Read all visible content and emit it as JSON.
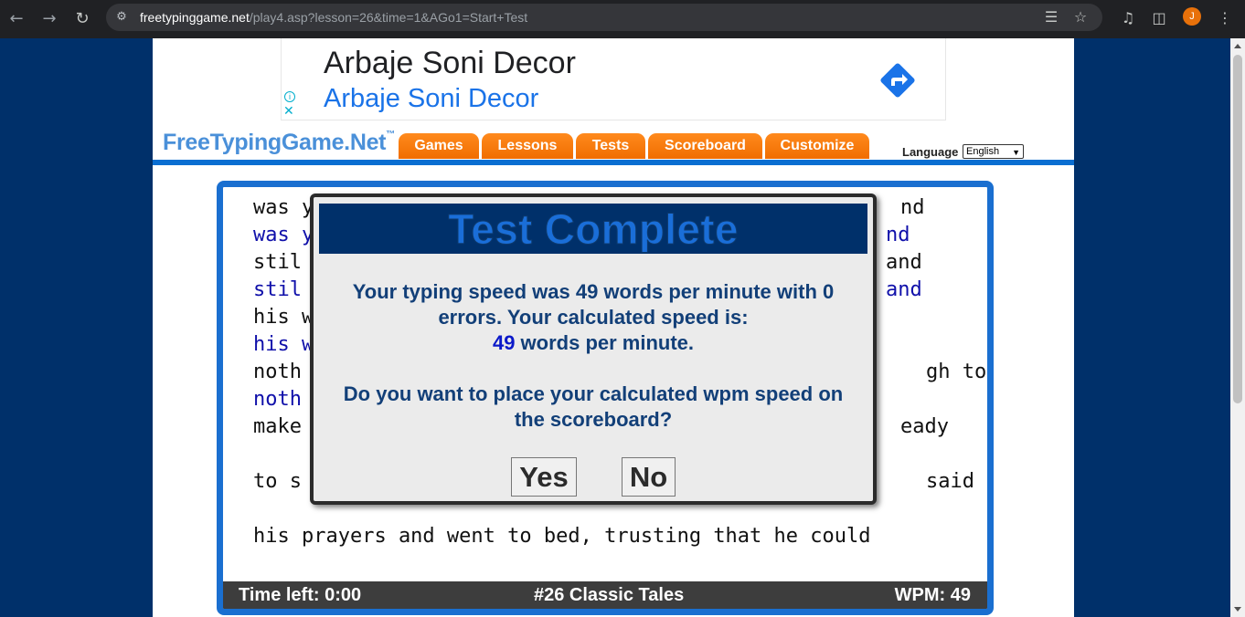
{
  "browser": {
    "url_host": "freetypinggame.net",
    "url_path": "/play4.asp?lesson=26&time=1&AGo1=Start+Test",
    "avatar_letter": "J"
  },
  "ad": {
    "headline": "Arbaje Soni Decor",
    "subline": "Arbaje Soni Decor"
  },
  "header": {
    "logo": "FreeTypingGame.Net",
    "logo_tm": "™",
    "nav": [
      "Games",
      "Lessons",
      "Tests",
      "Scoreboard",
      "Customize"
    ],
    "language_label": "Language",
    "language_value": "English"
  },
  "typing": {
    "lines": [
      {
        "visible": "was y",
        "right": "nd"
      },
      {
        "visible": "was y",
        "right": "nd"
      },
      {
        "visible": "stil",
        "right": "and"
      },
      {
        "visible": "stil",
        "right": "and"
      },
      {
        "visible": "his w",
        "right": ""
      },
      {
        "visible": "his w",
        "right": ""
      },
      {
        "visible": "noth",
        "right": "gh to"
      },
      {
        "visible": "noth",
        "right": ""
      },
      {
        "visible": "make",
        "right": "eady"
      },
      {
        "visible": "",
        "right": ""
      },
      {
        "visible": "to s",
        "right": "said"
      },
      {
        "visible": "",
        "right": ""
      },
      {
        "visible": "his prayers and went to bed, trusting that he could",
        "right": ""
      }
    ]
  },
  "status": {
    "time_left": "Time left: 0:00",
    "lesson": "#26 Classic Tales",
    "wpm": "WPM: 49"
  },
  "modal": {
    "title": "Test Complete",
    "line1": "Your typing speed was 49 words per minute with 0",
    "line2": "errors. Your calculated speed is:",
    "speed": "49",
    "speed_suffix": " words per minute.",
    "question_line1": "Do you want to place your calculated wpm speed on",
    "question_line2": "the scoreboard?",
    "yes_label": "Yes",
    "no_label": "No"
  }
}
